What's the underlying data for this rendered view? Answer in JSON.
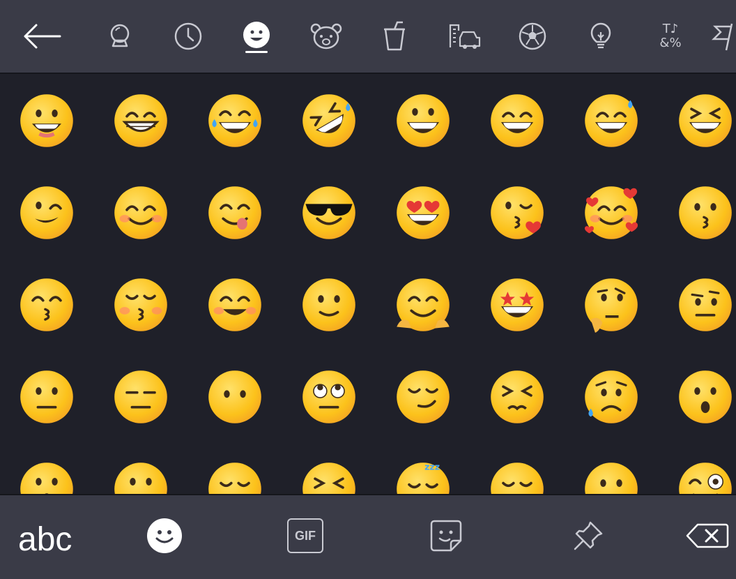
{
  "colors": {
    "bar": "#3a3b47",
    "background": "#1f2029",
    "icon": "#c9cad2",
    "active_icon": "#ffffff",
    "emoji_face": "#fcc21b",
    "emoji_dark": "#3b2a1a",
    "blush": "#ff8a65",
    "heart": "#e53935",
    "tear": "#42a5f5"
  },
  "category_tabs": [
    {
      "icon": "crystal-ball-icon"
    },
    {
      "icon": "clock-icon"
    },
    {
      "icon": "smiley-icon",
      "active": true
    },
    {
      "icon": "bear-icon"
    },
    {
      "icon": "cup-icon"
    },
    {
      "icon": "buildings-car-icon"
    },
    {
      "icon": "soccer-ball-icon"
    },
    {
      "icon": "lightbulb-icon"
    },
    {
      "icon": "symbols-icon",
      "text": [
        "T♪",
        "&%"
      ]
    },
    {
      "icon": "flag-icon"
    }
  ],
  "back_icon": "back-arrow-icon",
  "emojis": [
    [
      "grinning-face",
      "grinning-face-with-smiling-eyes",
      "face-with-tears-of-joy",
      "rolling-on-the-floor-laughing",
      "smiling-face-with-open-mouth",
      "smiling-face-with-open-mouth-and-smiling-eyes",
      "grinning-face-with-sweat",
      "grinning-squinting-face"
    ],
    [
      "winking-face",
      "smiling-face-with-smiling-eyes",
      "face-savoring-food",
      "smiling-face-with-sunglasses",
      "smiling-face-with-heart-eyes",
      "face-blowing-a-kiss",
      "smiling-face-with-hearts",
      "kissing-face"
    ],
    [
      "kissing-face-with-smiling-eyes",
      "kissing-face-with-closed-eyes",
      "smiling-face-blush",
      "slightly-smiling-face",
      "hugging-face",
      "star-struck",
      "thinking-face",
      "face-with-raised-eyebrow"
    ],
    [
      "neutral-face",
      "expressionless-face",
      "face-without-mouth",
      "face-with-rolling-eyes",
      "smirking-face",
      "persevering-face",
      "sad-but-relieved-face",
      "face-with-open-mouth"
    ],
    [
      "hushed-face",
      "zipper-mouth-face",
      "sleepy-face",
      "tired-face",
      "sleeping-face",
      "relieved-face",
      "face-with-tongue",
      "zany-face"
    ]
  ],
  "bottom": {
    "abc_label": "abc",
    "gif_label": "GIF",
    "icons": [
      "emoji-keyboard-icon",
      "gif-icon",
      "sticker-icon",
      "pin-icon",
      "backspace-icon"
    ]
  }
}
